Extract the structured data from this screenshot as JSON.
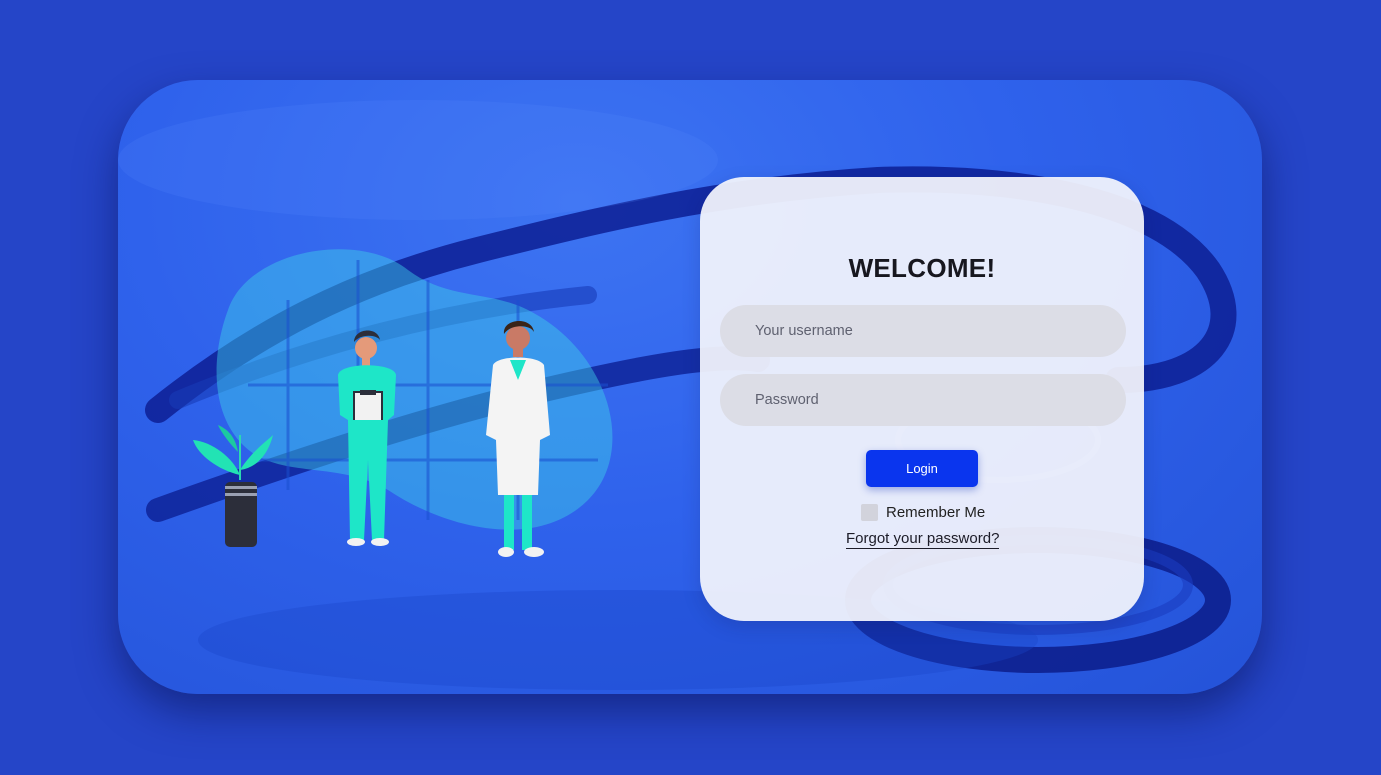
{
  "login": {
    "title": "WELCOME!",
    "username_placeholder": "Your username",
    "password_placeholder": "Password",
    "login_label": "Login",
    "remember_label": "Remember Me",
    "forgot_label": "Forgot your password?"
  },
  "colors": {
    "page_background": "#2545c8",
    "card_blue": "#2f62ec",
    "button_blue": "#0a35ee",
    "scrubs_teal": "#1ee6c8"
  }
}
